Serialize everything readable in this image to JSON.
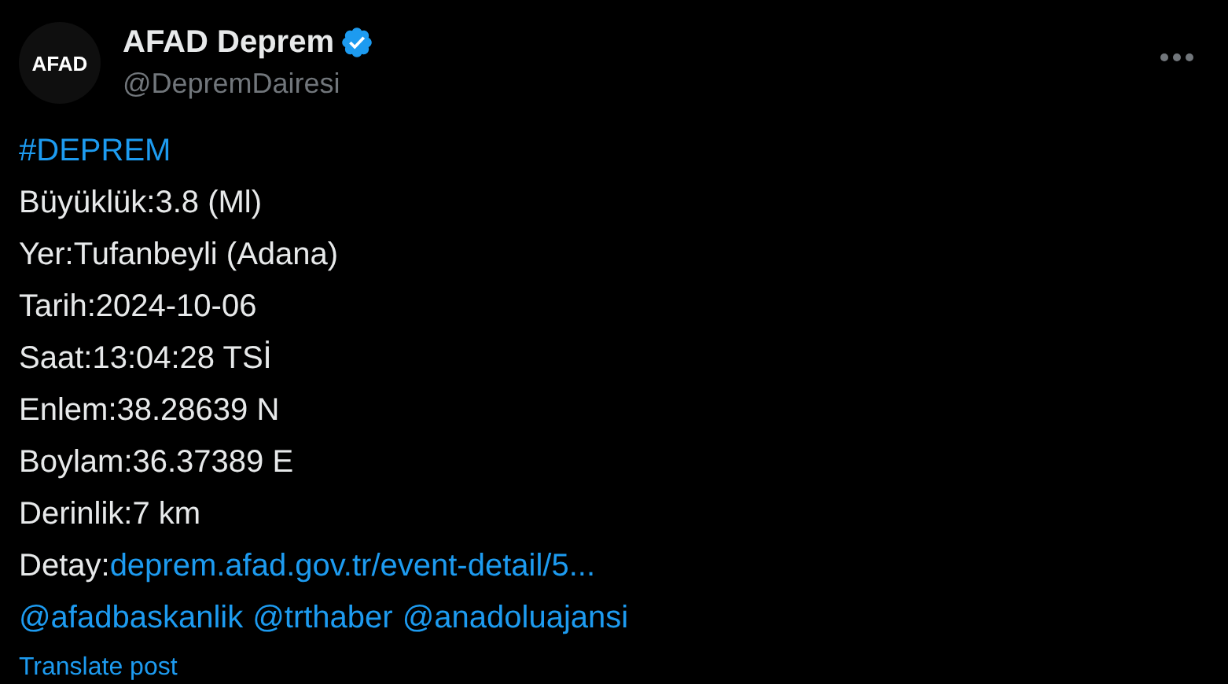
{
  "author": {
    "avatar_text": "AFAD",
    "name": "AFAD Deprem",
    "handle": "@DepremDairesi",
    "verified": true
  },
  "hashtag": "#DEPREM",
  "lines": [
    "Büyüklük:3.8 (Ml)",
    "Yer:Tufanbeyli (Adana)",
    "Tarih:2024-10-06",
    "Saat:13:04:28 TSİ",
    "Enlem:38.28639 N",
    "Boylam:36.37389 E",
    "Derinlik:7 km"
  ],
  "detail": {
    "label": "Detay:",
    "link": "deprem.afad.gov.tr/event-detail/5..."
  },
  "mentions": [
    "@afadbaskanlik",
    "@trthaber",
    "@anadoluajansi"
  ],
  "translate": "Translate post"
}
